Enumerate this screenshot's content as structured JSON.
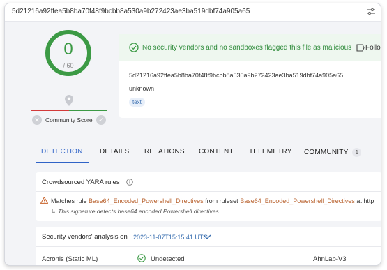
{
  "header": {
    "file_hash": "5d21216a92ffea5b8ba70f48f9bcbb8a530a9b272423ae3ba519dbf74a905a65",
    "menu_icon": "sliders-icon"
  },
  "score": {
    "detections": "0",
    "total": "/ 60",
    "community_label": "Community Score",
    "colors": {
      "ring": "#3c9a45",
      "bad": "#d33a3a",
      "good": "#3c9a45"
    }
  },
  "summary": {
    "status_message": "No security vendors and no sandboxes flagged this file as malicious",
    "follow_label": "Follo",
    "sha256": "5d21216a92ffea5b8ba70f48f9bcbb8a530a9b272423ae3ba519dbf74a905a65",
    "file_type": "unknown",
    "tag": "text"
  },
  "tabs": [
    {
      "label": "DETECTION",
      "active": true
    },
    {
      "label": "DETAILS"
    },
    {
      "label": "RELATIONS"
    },
    {
      "label": "CONTENT"
    },
    {
      "label": "TELEMETRY"
    },
    {
      "label": "COMMUNITY",
      "badge": "1"
    }
  ],
  "yara": {
    "title": "Crowdsourced YARA rules",
    "matches_prefix": "Matches rule",
    "rule_name": "Base64_Encoded_Powershell_Directives",
    "from_ruleset": "from ruleset",
    "ruleset_name": "Base64_Encoded_Powershell_Directives",
    "at_text": "at http",
    "description": "This signature detects base64 encoded Powershell directives."
  },
  "vendors": {
    "title": "Security vendors' analysis on",
    "date": "2023-11-07T15:15:41 UTC",
    "rows": [
      {
        "vendor": "Acronis (Static ML)",
        "result": "Undetected",
        "vendor2": "AhnLab-V3"
      }
    ]
  }
}
